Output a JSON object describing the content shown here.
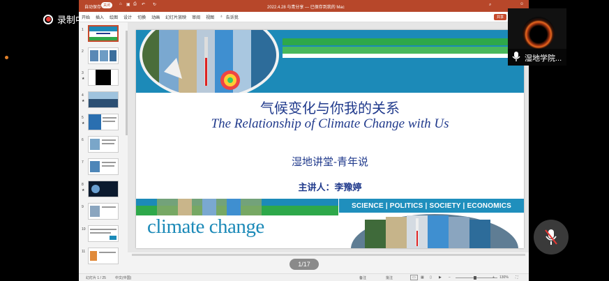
{
  "recording": {
    "label": "录制中"
  },
  "window": {
    "autosave_label": "自动保存",
    "autosave_toggle": "关闭",
    "title": "2022.4.28 与青分享 — 已保存到我的 Mac",
    "share_label": "共享"
  },
  "ribbon": {
    "tabs": [
      "开始",
      "插入",
      "绘图",
      "设计",
      "切换",
      "动画",
      "幻灯片放映",
      "审阅",
      "视图"
    ],
    "tellme": "告诉我"
  },
  "thumbnails": [
    {
      "num": "1",
      "star": ""
    },
    {
      "num": "2",
      "star": ""
    },
    {
      "num": "3",
      "star": "★"
    },
    {
      "num": "4",
      "star": "★"
    },
    {
      "num": "5",
      "star": "★"
    },
    {
      "num": "6",
      "star": ""
    },
    {
      "num": "7",
      "star": ""
    },
    {
      "num": "8",
      "star": "★"
    },
    {
      "num": "9",
      "star": ""
    },
    {
      "num": "10",
      "star": ""
    },
    {
      "num": "11",
      "star": ""
    }
  ],
  "slide": {
    "title_cn": "气候变化与你我的关系",
    "title_en": "The Relationship of Climate Change with Us",
    "series": "湿地讲堂-青年说",
    "speaker": "主讲人：李豫婷",
    "subjects": "SCIENCE | POLITICS | SOCIETY | ECONOMICS",
    "banner_text": "climate change"
  },
  "pager": {
    "label": "1/17"
  },
  "statusbar": {
    "slide_info": "幻灯片 1 / 25",
    "language": "中文(中国)",
    "notes": "备注",
    "comments": "批注",
    "zoom": "130%"
  },
  "participant": {
    "name": "湿地学院..."
  },
  "colors": {
    "ppt_accent": "#b7472a",
    "slide_blue": "#1c8ab8",
    "slide_green": "#2ea84a",
    "title_navy": "#203a8c",
    "rec_red": "#e53935"
  }
}
